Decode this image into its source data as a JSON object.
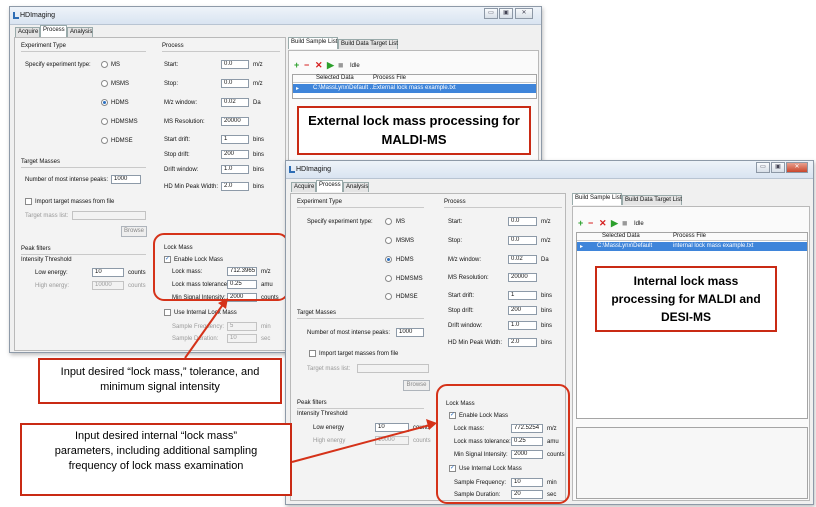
{
  "windows": [
    {
      "title": "HDImaging",
      "tabs": [
        "Acquire",
        "Process",
        "Analysis"
      ],
      "active_tab": "Process",
      "controls": [
        "▭",
        "▣",
        "✕"
      ],
      "experiment_type": {
        "header": "Experiment Type",
        "label": "Specify experiment type:",
        "options": [
          "MS",
          "MSMS",
          "HDMS",
          "HDMSMS",
          "HDMSE"
        ],
        "selected": "HDMS"
      },
      "target_masses": {
        "header": "Target Masses",
        "peaks_label": "Number of most intense peaks:",
        "peaks_value": "1000",
        "import_label": "Import target masses from file",
        "mass_list_label": "Target mass list:",
        "browse": "Browse"
      },
      "peak_filters": {
        "header": "Peak filters",
        "threshold": "Intensity Threshold",
        "low_label": "Low energy:",
        "low_value": "10",
        "high_label": "High energy:",
        "high_value": "10000",
        "unit": "counts"
      },
      "process": {
        "header": "Process",
        "rows": [
          {
            "label": "Start:",
            "value": "0.0",
            "unit": "m/z"
          },
          {
            "label": "Stop:",
            "value": "0.0",
            "unit": "m/z"
          },
          {
            "label": "M/z window:",
            "value": "0.02",
            "unit": "Da"
          },
          {
            "label": "MS Resolution:",
            "value": "20000",
            "unit": ""
          },
          {
            "label": "Start drift:",
            "value": "1",
            "unit": "bins"
          },
          {
            "label": "Stop drift:",
            "value": "200",
            "unit": "bins"
          },
          {
            "label": "Drift window:",
            "value": "1.0",
            "unit": "bins"
          },
          {
            "label": "HD Min Peak Width:",
            "value": "2.0",
            "unit": "bins"
          }
        ]
      },
      "lock_mass": {
        "header": "Lock Mass",
        "enable_label": "Enable Lock Mass",
        "mass_label": "Lock mass:",
        "mass_value": "712.3965",
        "mass_unit": "m/z",
        "tol_label": "Lock mass tolerance:",
        "tol_value": "0.25",
        "tol_unit": "amu",
        "min_label": "Min Signal Intensity:",
        "min_value": "2000",
        "min_unit": "counts",
        "internal_label": "Use Internal Lock Mass",
        "freq_label": "Sample Frequency:",
        "freq_value": "5",
        "freq_unit": "min",
        "dur_label": "Sample Duration:",
        "dur_value": "10",
        "dur_unit": "sec"
      },
      "sample_tabs": [
        "Build Sample List",
        "Build Data Target List"
      ],
      "idle": "Idle",
      "table": {
        "headers": [
          "Selected Data",
          "Process File"
        ],
        "row": [
          "C:\\MassLynx\\Default ...",
          "External lock mass example.txt"
        ]
      }
    },
    {
      "title": "HDImaging",
      "tabs": [
        "Acquire",
        "Process",
        "Analysis"
      ],
      "active_tab": "Process",
      "controls": [
        "▭",
        "▣",
        "✕"
      ],
      "experiment_type": {
        "header": "Experiment Type",
        "label": "Specify experiment type:",
        "options": [
          "MS",
          "MSMS",
          "HDMS",
          "HDMSMS",
          "HDMSE"
        ],
        "selected": "HDMS"
      },
      "target_masses": {
        "header": "Target Masses",
        "peaks_label": "Number of most intense peaks:",
        "peaks_value": "1000",
        "import_label": "Import target masses from file",
        "mass_list_label": "Target mass list:",
        "browse": "Browse"
      },
      "peak_filters": {
        "header": "Peak filters",
        "threshold": "Intensity Threshold",
        "low_label": "Low energy",
        "low_value": "10",
        "high_label": "High energy",
        "high_value": "10000",
        "unit": "counts"
      },
      "process": {
        "header": "Process",
        "rows": [
          {
            "label": "Start:",
            "value": "0.0",
            "unit": "m/z"
          },
          {
            "label": "Stop:",
            "value": "0.0",
            "unit": "m/z"
          },
          {
            "label": "M/z window:",
            "value": "0.02",
            "unit": "Da"
          },
          {
            "label": "MS Resolution:",
            "value": "20000",
            "unit": ""
          },
          {
            "label": "Start drift:",
            "value": "1",
            "unit": "bins"
          },
          {
            "label": "Stop drift:",
            "value": "200",
            "unit": "bins"
          },
          {
            "label": "Drift window:",
            "value": "1.0",
            "unit": "bins"
          },
          {
            "label": "HD Min Peak Width:",
            "value": "2.0",
            "unit": "bins"
          }
        ]
      },
      "lock_mass": {
        "header": "Lock Mass",
        "enable_label": "Enable Lock Mass",
        "mass_label": "Lock mass:",
        "mass_value": "772.5254",
        "mass_unit": "m/z",
        "tol_label": "Lock mass tolerance:",
        "tol_value": "0.25",
        "tol_unit": "amu",
        "min_label": "Min Signal Intensity:",
        "min_value": "2000",
        "min_unit": "counts",
        "internal_label": "Use Internal Lock Mass",
        "freq_label": "Sample Frequency:",
        "freq_value": "10",
        "freq_unit": "min",
        "dur_label": "Sample Duration:",
        "dur_value": "20",
        "dur_unit": "sec"
      },
      "sample_tabs": [
        "Build Sample List",
        "Build Data Target List"
      ],
      "idle": "Idle",
      "table": {
        "headers": [
          "Selected Data",
          "Process File"
        ],
        "row": [
          "C:\\MassLynx\\Default",
          "internal lock mass example.txt"
        ]
      }
    }
  ],
  "callouts": {
    "external": "External lock mass processing for MALDI-MS",
    "internal": "Internal lock mass processing for MALDI and DESI-MS",
    "input1": "Input desired “lock mass,” tolerance, and minimum signal intensity",
    "input2": "Input desired internal “lock mass” parameters, including additional sampling frequency of lock mass examination"
  },
  "colors": {
    "accent": "#d53219",
    "selection": "#3f85da"
  }
}
